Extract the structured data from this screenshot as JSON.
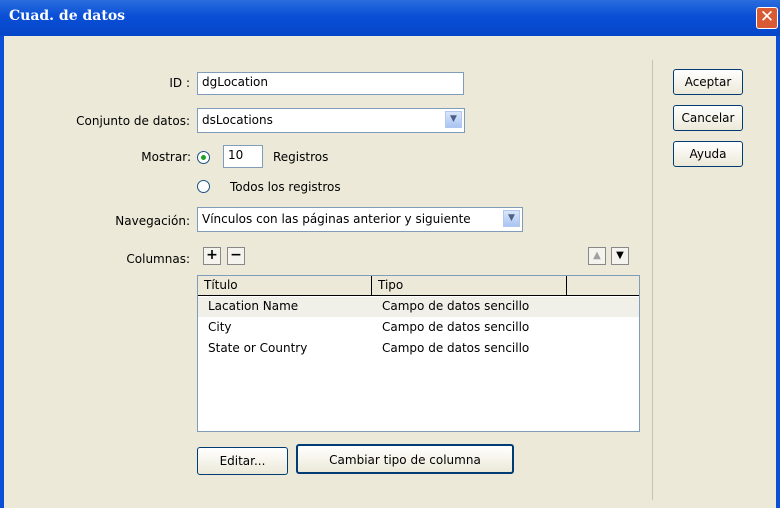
{
  "window": {
    "title": "Cuad. de datos",
    "close_symbol": "✕"
  },
  "form": {
    "id_label": "ID :",
    "id_value": "dgLocation",
    "dataset_label": "Conjunto de datos:",
    "dataset_value": "dsLocations",
    "show_label": "Mostrar:",
    "show_count": "10",
    "show_unit": "Registros",
    "all_records_label": "Todos los registros",
    "nav_label": "Navegación:",
    "nav_value": "Vínculos con las páginas anterior y siguiente",
    "columns_label": "Columnas:",
    "selected_radio": "records"
  },
  "toolbar": {
    "add": "+",
    "remove": "−",
    "up": "▲",
    "down": "▼"
  },
  "table": {
    "headers": [
      "Título",
      "Tipo"
    ],
    "rows": [
      [
        "Lacation Name",
        "Campo de datos sencillo"
      ],
      [
        "City",
        "Campo de datos sencillo"
      ],
      [
        "State or Country",
        "Campo de datos sencillo"
      ]
    ],
    "selected_row": 0
  },
  "buttons": {
    "edit": "Editar...",
    "change_type": "Cambiar tipo de columna",
    "ok": "Aceptar",
    "cancel": "Cancelar",
    "help": "Ayuda"
  }
}
